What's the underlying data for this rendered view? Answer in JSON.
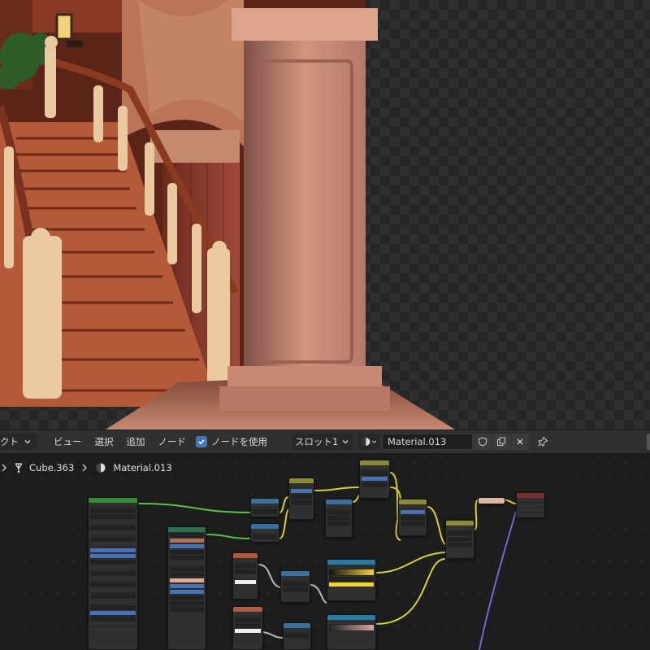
{
  "header": {
    "object_menu": "クト",
    "menus": [
      "ビュー",
      "選択",
      "追加",
      "ノード"
    ],
    "use_nodes_label": "ノードを使用",
    "use_nodes_checked": true,
    "slot": "スロット1",
    "material_name": "Material.013"
  },
  "breadcrumb": {
    "object": "Cube.363",
    "material": "Material.013"
  },
  "colors": {
    "header_bg": "#303030",
    "editor_bg": "#1d1d1d",
    "accent_blue": "#4772b3",
    "wire_yellow": "#d8d030",
    "wire_green": "#5fc04c",
    "wire_blue": "#6a6ad8"
  },
  "icons": [
    "chevron-down-icon",
    "shading-icon",
    "shield-icon",
    "copy-icon",
    "close-icon",
    "pin-icon",
    "chevron-right-icon",
    "object-data-icon",
    "material-icon",
    "check-icon"
  ]
}
